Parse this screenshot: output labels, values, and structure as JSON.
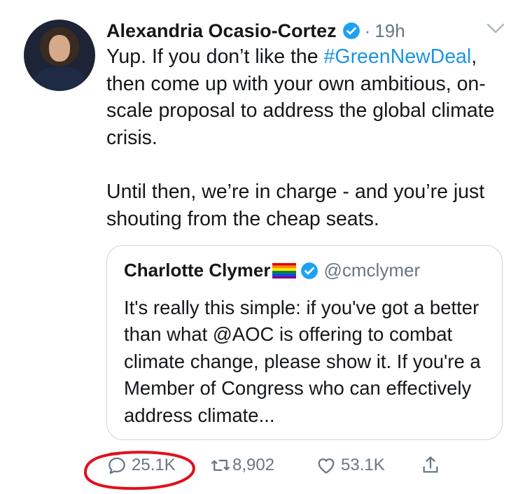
{
  "author": {
    "name": "Alexandria Ocasio-Cortez",
    "time": "19h",
    "separator": "·"
  },
  "tweet": {
    "line1": "Yup. If you don’t like the ",
    "hashtag": "#GreenNewDeal",
    "line2": ", then come up with your own ambitious, on-scale proposal to address the global climate crisis.\n\nUntil then, we’re in charge - and you’re just shouting from the cheap seats."
  },
  "quoted": {
    "name": "Charlotte Clymer",
    "handle": "@cmclymer",
    "text": "It's really this simple: if you've got a better than what @AOC is offering to combat climate change, please show it. If you're a Member of Congress who can effectively address climate..."
  },
  "actions": {
    "replies": "25.1K",
    "retweets": "8,902",
    "likes": "53.1K"
  },
  "colors": {
    "link": "#1b95e0",
    "verified": "#1da1f2",
    "muted": "#657786",
    "annotation": "#e0101c"
  },
  "icons": [
    "verified-badge-icon",
    "chevron-down-icon",
    "reply-icon",
    "retweet-icon",
    "like-icon",
    "share-icon",
    "rainbow-flag-icon"
  ]
}
